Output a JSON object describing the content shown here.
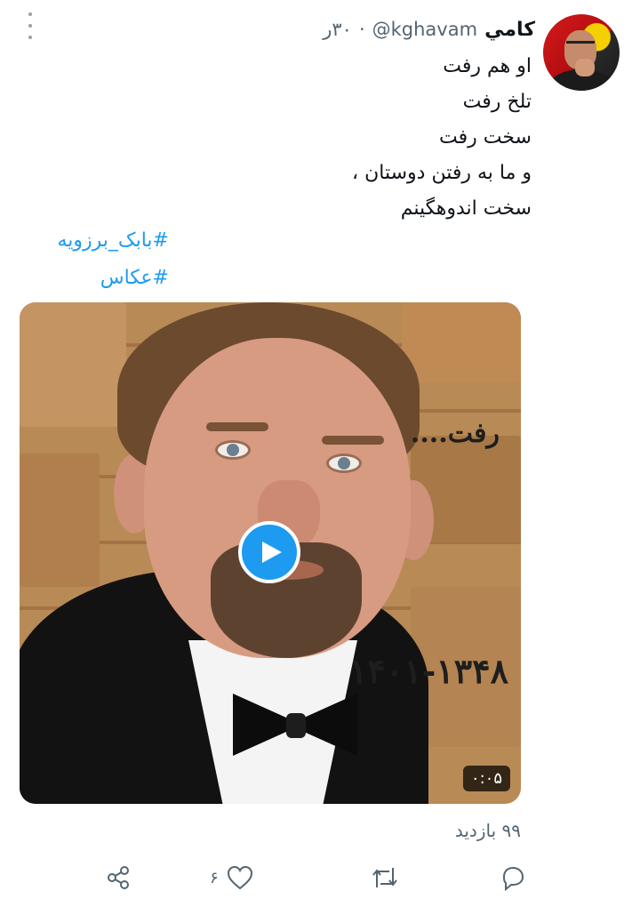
{
  "tweet": {
    "name": "کامي",
    "handle": "@kghavam",
    "separator": "·",
    "time": "۳۰ر",
    "lines": [
      "او هم رفت",
      "تلخ رفت",
      "سخت رفت",
      "و ما به رفتن دوستان ،",
      "سخت اندوهگینم"
    ],
    "hashtags": [
      "#بابک_برزویه",
      "#عکاس"
    ],
    "media": {
      "caption_top": "رفت....",
      "caption_years": "۱۴۰۱-۱۳۴۸",
      "duration": "۰:۰۵"
    },
    "views": "۹۹ بازدید",
    "actions": {
      "like_count": "۶",
      "reply_count": "",
      "retweet_count": ""
    }
  },
  "colors": {
    "accent": "#1d9bf0",
    "secondary_text": "#536471",
    "icon": "#536471"
  },
  "icons": [
    "more-icon",
    "share-icon",
    "like-icon",
    "retweet-icon",
    "reply-icon",
    "play-icon"
  ]
}
